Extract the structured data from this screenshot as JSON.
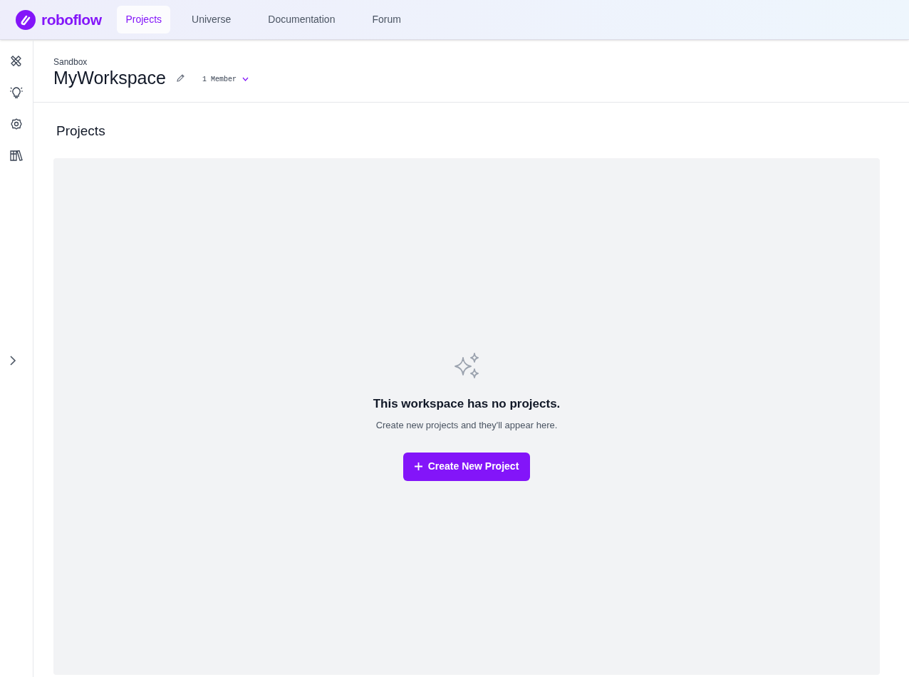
{
  "brand": {
    "name": "roboflow"
  },
  "nav": [
    {
      "label": "Projects",
      "selected": true
    },
    {
      "label": "Universe",
      "selected": false
    },
    {
      "label": "Documentation",
      "selected": false
    },
    {
      "label": "Forum",
      "selected": false
    }
  ],
  "sidebar": {
    "items": [
      {
        "kind": "tools"
      },
      {
        "kind": "idea"
      },
      {
        "kind": "settings"
      },
      {
        "kind": "library"
      }
    ]
  },
  "workspace": {
    "plan": "Sandbox",
    "name": "MyWorkspace",
    "members": "1 Member"
  },
  "section_title": "Projects",
  "empty_state": {
    "title": "This workspace has no projects.",
    "message": "Create new projects and they'll appear here.",
    "button": "Create New Project"
  }
}
